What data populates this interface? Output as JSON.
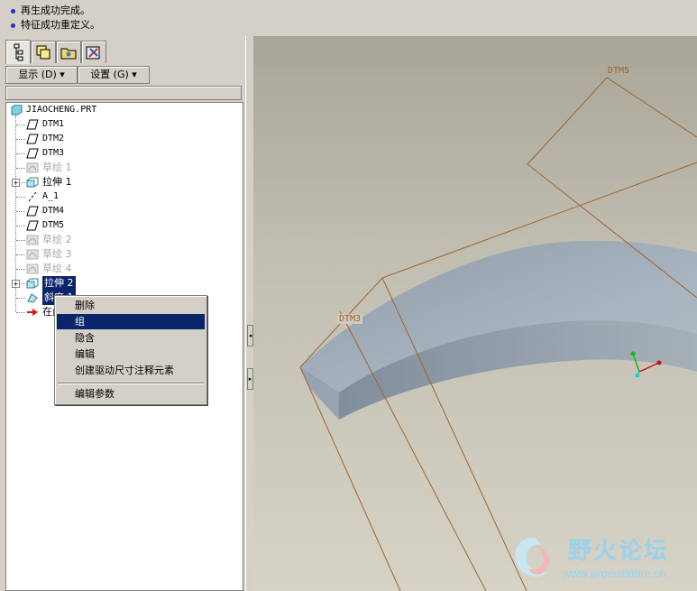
{
  "messages": [
    "再生成功完成。",
    "特征成功重定义。"
  ],
  "tabs": [
    {
      "name": "model-tree-tab",
      "icon": "tree-icon"
    },
    {
      "name": "layers-tab",
      "icon": "layers-icon"
    },
    {
      "name": "folder-tab",
      "icon": "folder-icon"
    },
    {
      "name": "favorites-tab",
      "icon": "tools-icon"
    }
  ],
  "toolbar": {
    "show_label": "显示 (D) ▾",
    "settings_label": "设置 (G) ▾"
  },
  "tree": {
    "root": "JIAOCHENG.PRT",
    "items": [
      {
        "label": "DTM1",
        "kind": "datum"
      },
      {
        "label": "DTM2",
        "kind": "datum"
      },
      {
        "label": "DTM3",
        "kind": "datum"
      },
      {
        "label": "草绘 1",
        "kind": "sketch",
        "suppressed": true
      },
      {
        "label": "拉伸 1",
        "kind": "extrude"
      },
      {
        "label": "A_1",
        "kind": "axis"
      },
      {
        "label": "DTM4",
        "kind": "datum"
      },
      {
        "label": "DTM5",
        "kind": "datum"
      },
      {
        "label": "草绘 2",
        "kind": "sketch",
        "suppressed": true
      },
      {
        "label": "草绘 3",
        "kind": "sketch",
        "suppressed": true
      },
      {
        "label": "草绘 4",
        "kind": "sketch",
        "suppressed": true
      },
      {
        "label": "拉伸 2",
        "kind": "extrude",
        "selected": true
      },
      {
        "label": "斜度 1",
        "kind": "draft",
        "selected": true
      },
      {
        "label": "在此插入",
        "kind": "insert"
      }
    ]
  },
  "context_menu": {
    "items": [
      "删除",
      "组",
      "隐含",
      "编辑",
      "创建驱动尺寸注释元素",
      "编辑参数"
    ],
    "highlighted": "组"
  },
  "viewport": {
    "datum_labels": {
      "dtm5": "DTM5",
      "dtm3": "DTM3"
    },
    "colors": {
      "datum": "#a0642c",
      "solid": "#9aa8b4"
    }
  },
  "watermark": {
    "title": "野火论坛",
    "url": "www.proewildfire.cn"
  }
}
